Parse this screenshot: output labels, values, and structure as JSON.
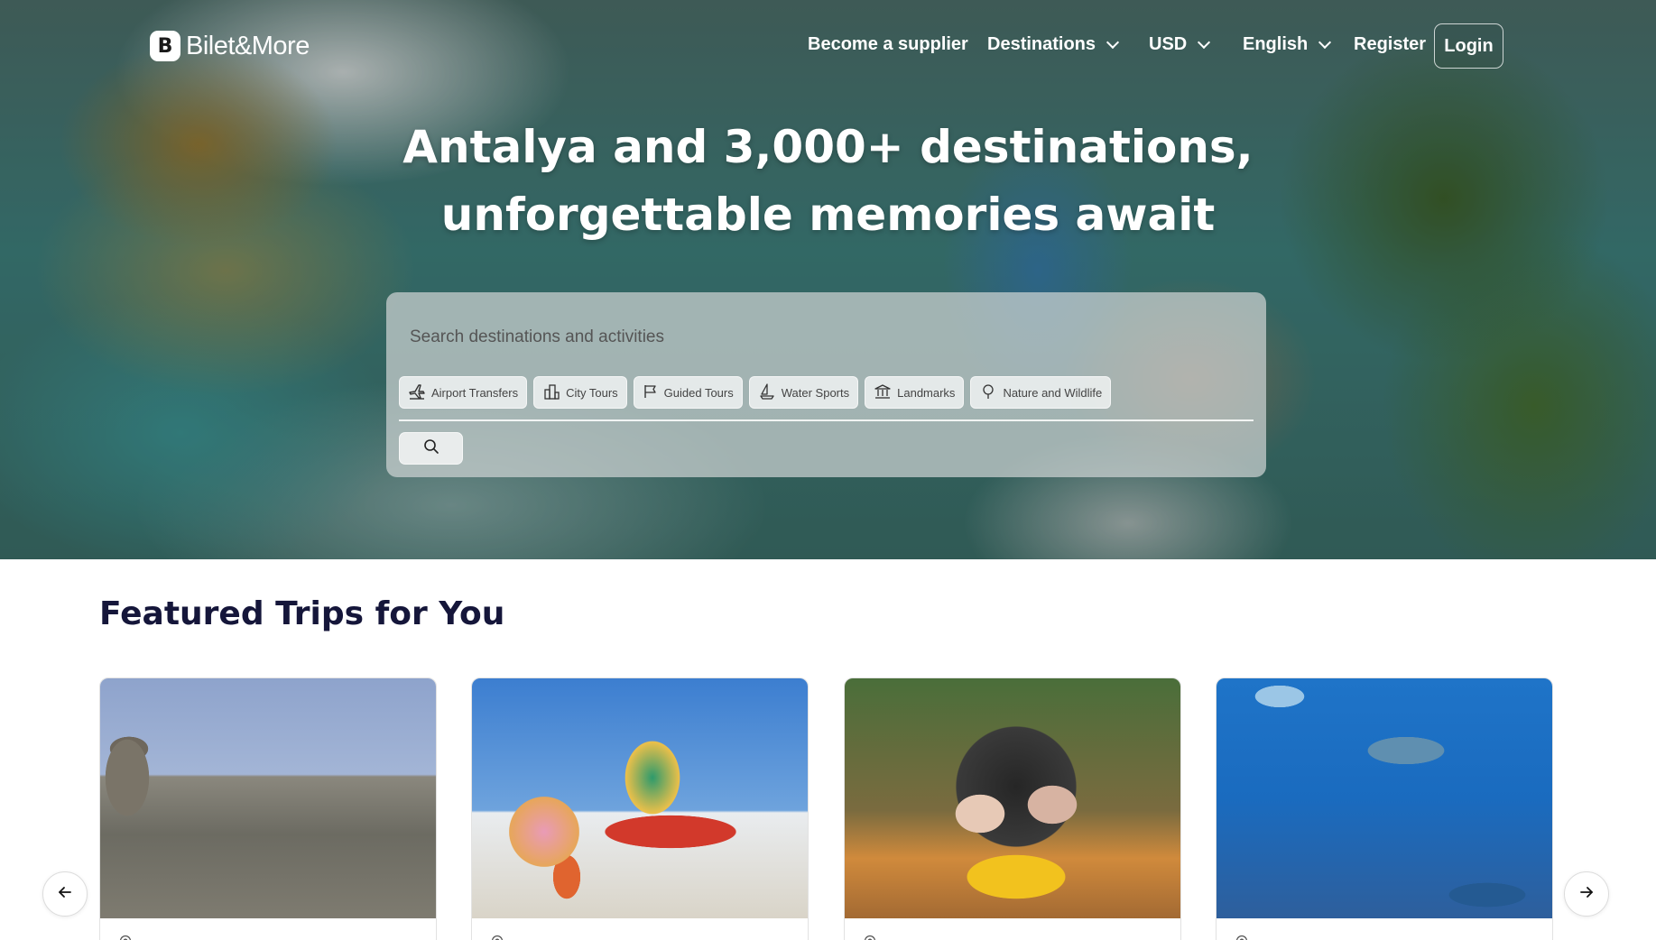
{
  "brand": {
    "name": "Bilet&More",
    "mark": "B"
  },
  "nav": {
    "become_supplier": "Become a supplier",
    "destinations": "Destinations",
    "currency": "USD",
    "language": "English",
    "register": "Register",
    "login": "Login"
  },
  "hero": {
    "headline_line1": "Antalya and 3,000+ destinations,",
    "headline_line2": "unforgettable memories await"
  },
  "search": {
    "placeholder": "Search destinations and activities",
    "categories": [
      {
        "label": "Airport Transfers",
        "icon": "airplane-icon"
      },
      {
        "label": "City Tours",
        "icon": "city-icon"
      },
      {
        "label": "Guided Tours",
        "icon": "flag-icon"
      },
      {
        "label": "Water Sports",
        "icon": "sailboat-icon"
      },
      {
        "label": "Landmarks",
        "icon": "landmark-icon"
      },
      {
        "label": "Nature and Wildlife",
        "icon": "tree-icon"
      }
    ],
    "button_icon": "search-icon"
  },
  "featured": {
    "title": "Featured Trips for You",
    "cards": [
      {
        "image": "rock formations landscape",
        "location_icon": "location-pin-icon"
      },
      {
        "image": "water park with couple",
        "location_icon": "location-pin-icon"
      },
      {
        "image": "buggy safari riders",
        "location_icon": "location-pin-icon"
      },
      {
        "image": "aquarium whale sharks",
        "location_icon": "location-pin-icon"
      }
    ],
    "prev_icon": "arrow-left-icon",
    "next_icon": "arrow-right-icon"
  },
  "colors": {
    "heading": "#15163a",
    "white": "#ffffff",
    "panel": "rgba(205,210,210,0.72)"
  }
}
